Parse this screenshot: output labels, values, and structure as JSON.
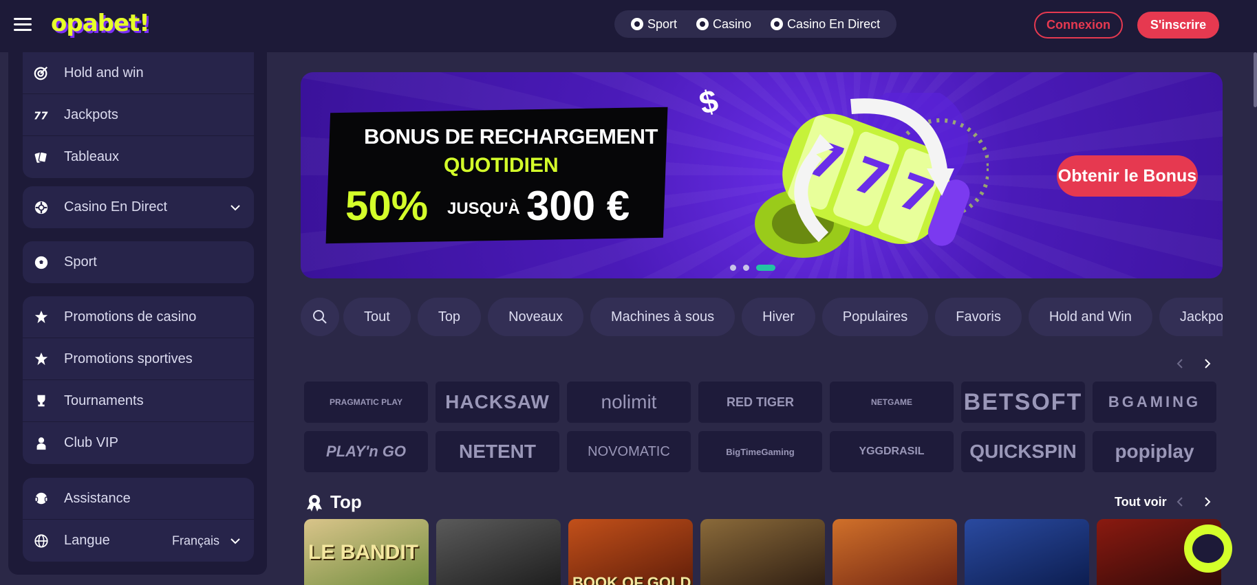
{
  "header": {
    "logo": "opabet!",
    "nav": [
      {
        "label": "Sport",
        "icon": "soccer-ball-icon"
      },
      {
        "label": "Casino",
        "icon": "casino-chip-icon"
      },
      {
        "label": "Casino En Direct",
        "icon": "live-casino-icon"
      }
    ],
    "login_label": "Connexion",
    "signup_label": "S'inscrire"
  },
  "sidebar": {
    "group1": [
      {
        "label": "Hold and win",
        "icon": "target-icon"
      },
      {
        "label": "Jackpots",
        "icon": "jackpot-sevens-icon"
      },
      {
        "label": "Tableaux",
        "icon": "cards-icon"
      }
    ],
    "live_casino": {
      "label": "Casino En Direct",
      "icon": "live-casino-icon"
    },
    "sport": {
      "label": "Sport",
      "icon": "soccer-ball-icon"
    },
    "group3": [
      {
        "label": "Promotions de casino",
        "icon": "promo-star-icon"
      },
      {
        "label": "Promotions sportives",
        "icon": "promo-star-icon"
      },
      {
        "label": "Tournaments",
        "icon": "trophy-icon"
      },
      {
        "label": "Club VIP",
        "icon": "user-icon"
      }
    ],
    "support": {
      "label": "Assistance",
      "icon": "headset-icon"
    },
    "language": {
      "label": "Langue",
      "value": "Français",
      "icon": "globe-icon"
    }
  },
  "banner": {
    "line1": "BONUS DE RECHARGEMENT",
    "line2": "QUOTIDIEN",
    "percent": "50%",
    "upto": "JUSQU'À",
    "amount": "300 €",
    "cta": "Obtenir le Bonus",
    "active_slide": 3
  },
  "filters": [
    "Tout",
    "Top",
    "Noveaux",
    "Machines à sous",
    "Hiver",
    "Populaires",
    "Favoris",
    "Hold and Win",
    "Jackpots"
  ],
  "providers": [
    "PRAGMATIC PLAY",
    "HACKSAW",
    "nolimit",
    "RED TIGER",
    "NETGAME",
    "BETSOFT",
    "BGAMING",
    "PLAY'n GO",
    "NETENT",
    "NOVOMATIC",
    "BigTimeGaming",
    "YGGDRASIL",
    "QUICKSPIN",
    "popiplay"
  ],
  "top_section": {
    "title": "Top",
    "see_all": "Tout voir",
    "games": [
      {
        "title": "LE BANDIT",
        "color_a": "#d9c48a",
        "color_b": "#6b8a3a"
      },
      {
        "title": "",
        "color_a": "#5a5a5a",
        "color_b": "#1a1a1a"
      },
      {
        "title": "BOOK OF GOLD",
        "color_a": "#c2501a",
        "color_b": "#5a1a08"
      },
      {
        "title": "",
        "color_a": "#8a6a3a",
        "color_b": "#2a1a10"
      },
      {
        "title": "",
        "color_a": "#d0702a",
        "color_b": "#6a2010"
      },
      {
        "title": "",
        "color_a": "#2a4aa0",
        "color_b": "#0a1a4a"
      },
      {
        "title": "",
        "color_a": "#8a1a10",
        "color_b": "#2a0808"
      }
    ]
  },
  "colors": {
    "accent": "#e63950",
    "lime": "#d4ff2a",
    "bg": "#2b2847",
    "panel": "#1d1a38"
  }
}
